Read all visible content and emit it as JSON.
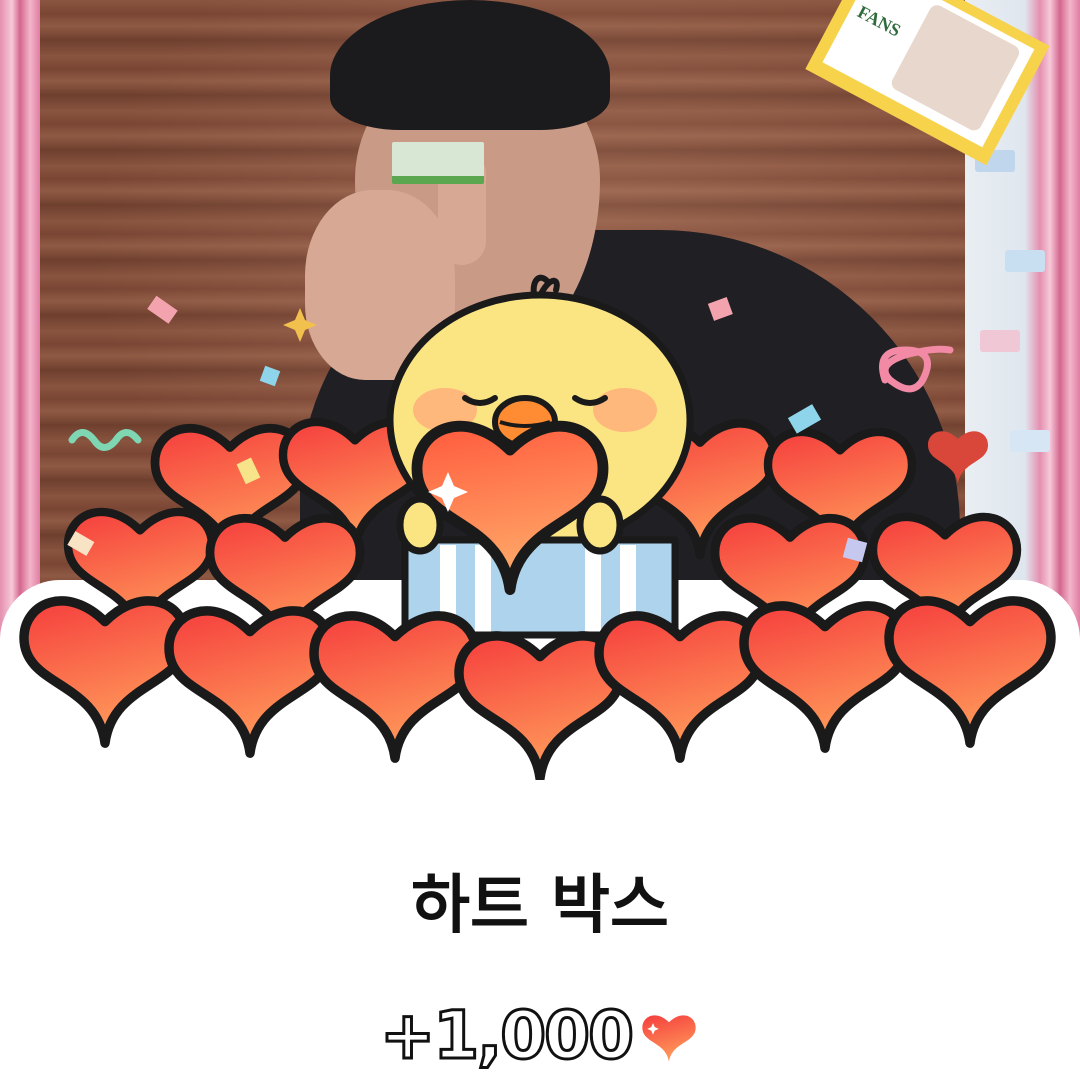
{
  "reward": {
    "title": "하트 박스",
    "amount": "+1,000",
    "currency_icon": "heart-icon"
  },
  "illustration": {
    "mascot_icon": "chick-mascot-icon",
    "decoration": "confetti"
  },
  "background": {
    "sticker_text": "FANS"
  },
  "colors": {
    "heart_top": "#f53d3d",
    "heart_bottom": "#ff9a5a",
    "chick": "#fbe582",
    "text": "#111111",
    "frame_pink": "#e58fb0"
  }
}
